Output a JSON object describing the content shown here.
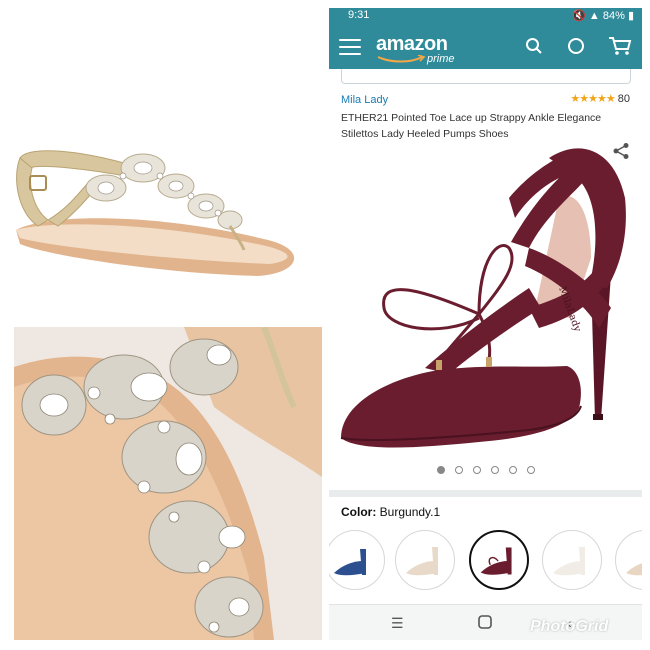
{
  "status_bar": {
    "time": "9:31",
    "battery": "84%"
  },
  "app_header": {
    "logo_word": "amazon",
    "logo_sub": "prime"
  },
  "product": {
    "brand": "Mila Lady",
    "rating_count": "80",
    "rating_stars": 4.5,
    "title": "ETHER21 Pointed Toe Lace up Strappy Ankle Elegance Stilettos Lady Heeled Pumps Shoes",
    "image_count": 6,
    "active_image_index": 0
  },
  "variation": {
    "color_label": "Color:",
    "color_value": "Burgundy.1",
    "swatches": [
      {
        "icon": "blue-heel-thumbnail",
        "selected": false
      },
      {
        "icon": "beige-heel-thumbnail",
        "selected": false
      },
      {
        "icon": "burgundy-heel-thumbnail",
        "selected": true
      },
      {
        "icon": "white-heel-thumbnail",
        "selected": false
      },
      {
        "icon": "tan-heel-thumbnail",
        "selected": false
      }
    ]
  },
  "navigation": {
    "recent_icon": "recent-apps-icon",
    "home_icon": "home-icon",
    "back_icon": "back-icon"
  },
  "watermark": {
    "text": "PhotoGrid"
  },
  "colors": {
    "app_bar": "#2f8b9a",
    "burgundy": "#6a1d2e",
    "star": "#f0a51b",
    "link": "#1a7bb3"
  }
}
